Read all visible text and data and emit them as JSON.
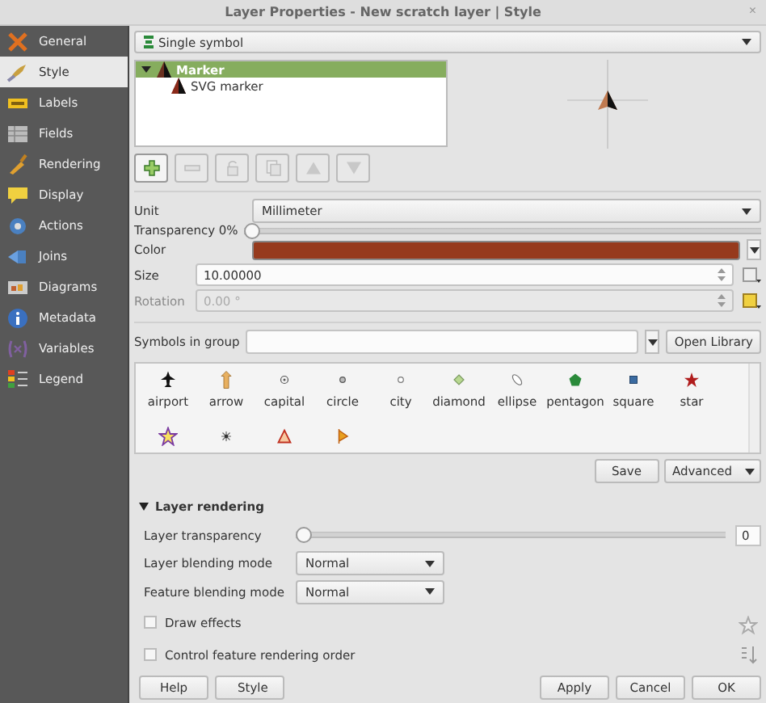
{
  "window": {
    "title": "Layer Properties - New scratch layer | Style",
    "close": "×"
  },
  "sidebar": {
    "items": [
      {
        "label": "General",
        "selected": false
      },
      {
        "label": "Style",
        "selected": true
      },
      {
        "label": "Labels",
        "selected": false
      },
      {
        "label": "Fields",
        "selected": false
      },
      {
        "label": "Rendering",
        "selected": false
      },
      {
        "label": "Display",
        "selected": false
      },
      {
        "label": "Actions",
        "selected": false
      },
      {
        "label": "Joins",
        "selected": false
      },
      {
        "label": "Diagrams",
        "selected": false
      },
      {
        "label": "Metadata",
        "selected": false
      },
      {
        "label": "Variables",
        "selected": false
      },
      {
        "label": "Legend",
        "selected": false
      }
    ]
  },
  "renderer": {
    "value": "Single symbol"
  },
  "symbol_tree": [
    {
      "label": "Marker",
      "selected": true,
      "expanded": true,
      "children": [
        {
          "label": "SVG marker",
          "selected": false
        }
      ]
    }
  ],
  "layer_toolbar": [
    {
      "kind": "add",
      "disabled": false
    },
    {
      "kind": "remove",
      "disabled": true
    },
    {
      "kind": "lock",
      "disabled": true
    },
    {
      "kind": "duplicate",
      "disabled": true
    },
    {
      "kind": "up",
      "disabled": true
    },
    {
      "kind": "down",
      "disabled": true
    }
  ],
  "unit": {
    "label": "Unit",
    "value": "Millimeter"
  },
  "transparency": {
    "label": "Transparency 0%",
    "level": 0
  },
  "color": {
    "label": "Color",
    "color": "#963a1d"
  },
  "size": {
    "label": "Size",
    "value": "10.00000"
  },
  "rotation": {
    "label": "Rotation",
    "value": "0.00 °",
    "disabled": true
  },
  "symbols_in_group": {
    "label": "Symbols in group",
    "open_library": "Open Library"
  },
  "symbols": [
    {
      "kind": "airport",
      "name": "airport"
    },
    {
      "kind": "arrow",
      "name": "arrow"
    },
    {
      "kind": "capital",
      "name": "capital"
    },
    {
      "kind": "circle",
      "name": "circle"
    },
    {
      "kind": "city",
      "name": "city"
    },
    {
      "kind": "diamond",
      "name": "diamond"
    },
    {
      "kind": "ellipse",
      "name": "ellipse"
    },
    {
      "kind": "pentagon",
      "name": "pentagon"
    },
    {
      "kind": "square",
      "name": "square"
    },
    {
      "kind": "star",
      "name": "star"
    },
    {
      "kind": "outline-star"
    },
    {
      "kind": "dot"
    },
    {
      "kind": "triangle"
    },
    {
      "kind": "half-arrow"
    }
  ],
  "symbol_actions": {
    "save": "Save",
    "advanced": "Advanced"
  },
  "layer_rendering": {
    "title": "Layer rendering",
    "expanded": true,
    "transparency": {
      "label": "Layer transparency",
      "level": 0,
      "value": "0"
    },
    "blending": [
      {
        "label": "Layer blending mode",
        "value": "Normal"
      },
      {
        "label": "Feature blending mode",
        "value": "Normal"
      }
    ],
    "options": [
      {
        "label": "Draw effects",
        "checked": false
      },
      {
        "label": "Control feature rendering order",
        "checked": false
      }
    ]
  },
  "buttons": [
    {
      "label": "Help",
      "kind": "plain"
    },
    {
      "label": "Style",
      "kind": "menu"
    },
    {
      "label": "Apply",
      "kind": "plain"
    },
    {
      "label": "Cancel",
      "kind": "plain"
    },
    {
      "label": "OK",
      "kind": "plain"
    }
  ]
}
